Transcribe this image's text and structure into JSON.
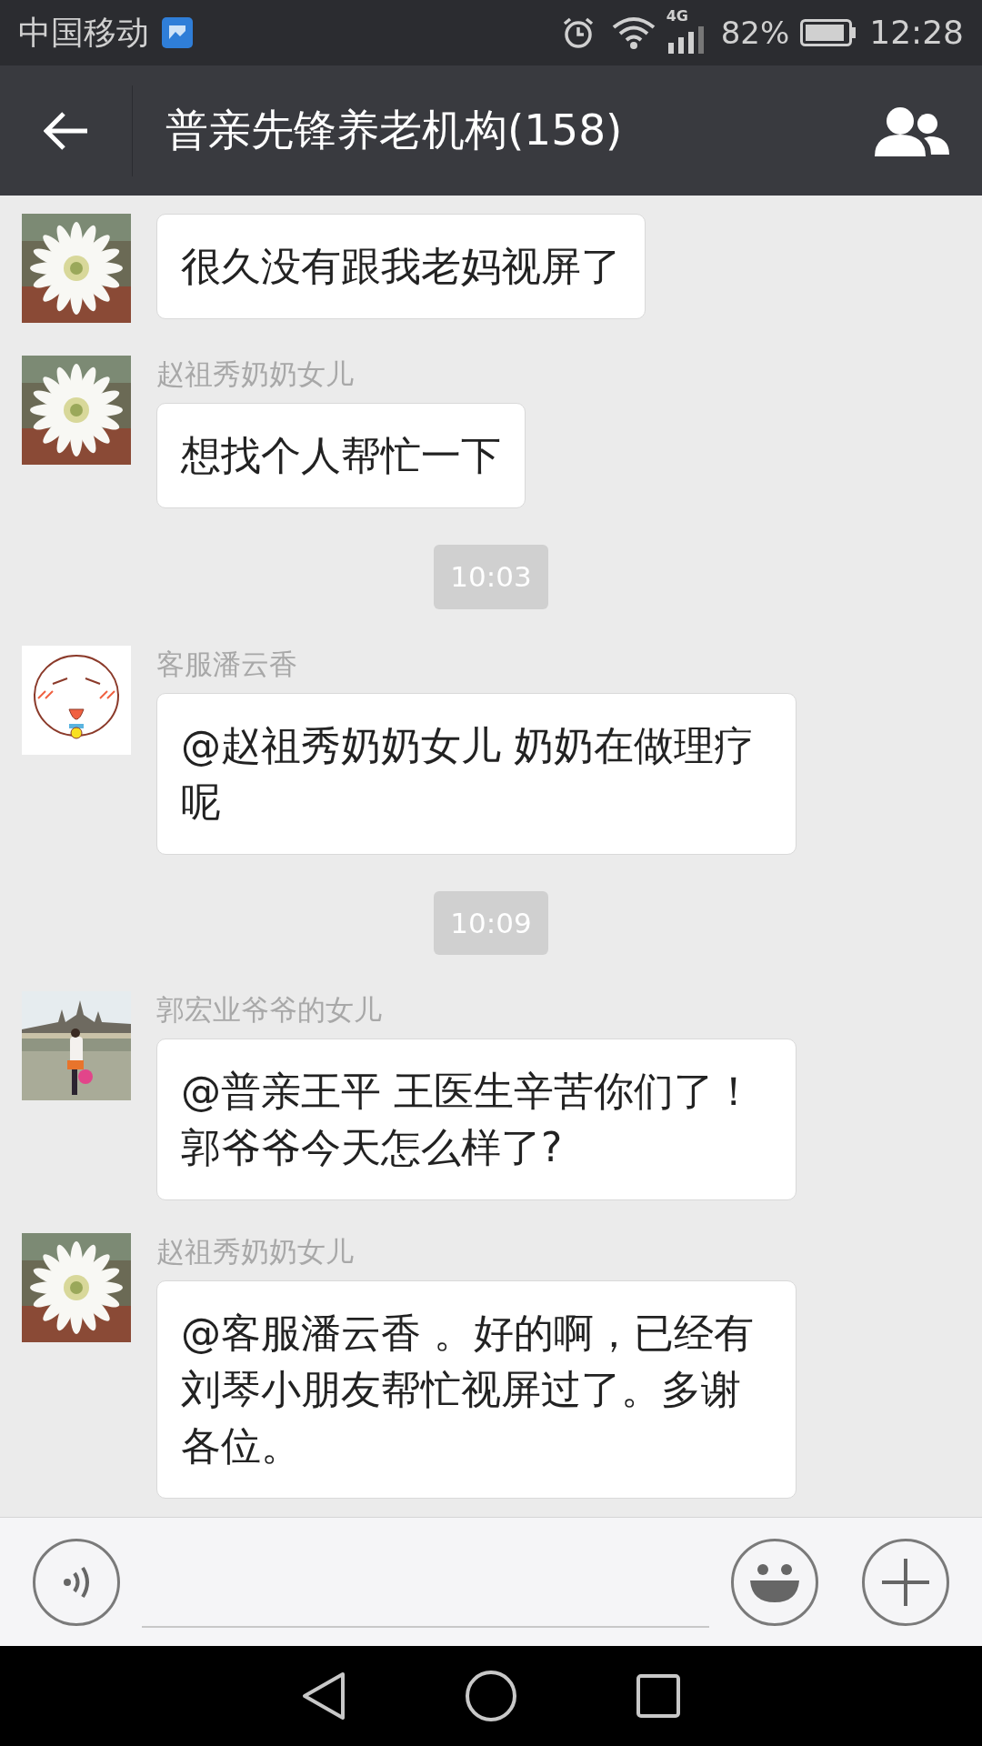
{
  "status_bar": {
    "carrier": "中国移动",
    "network": "4G",
    "battery": "82%",
    "time": "12:28"
  },
  "header": {
    "title": "普亲先锋养老机构(158)"
  },
  "messages": [
    {
      "kind": "message",
      "avatar": {
        "kind": "flower"
      },
      "text": "很久没有跟我老妈视屏了"
    },
    {
      "kind": "message",
      "avatar": {
        "kind": "flower"
      },
      "sender": "赵祖秀奶奶女儿",
      "text": "想找个人帮忙一下"
    },
    {
      "kind": "time",
      "text": "10:03"
    },
    {
      "kind": "message",
      "avatar": {
        "kind": "cat"
      },
      "sender": "客服潘云香",
      "text": "@赵祖秀奶奶女儿 奶奶在做理疗呢"
    },
    {
      "kind": "time",
      "text": "10:09"
    },
    {
      "kind": "message",
      "avatar": {
        "kind": "lake"
      },
      "sender": "郭宏业爷爷的女儿",
      "text": "@普亲王平 王医生辛苦你们了！郭爷爷今天怎么样了?"
    },
    {
      "kind": "message",
      "avatar": {
        "kind": "flower"
      },
      "sender": "赵祖秀奶奶女儿",
      "text": "@客服潘云香 。好的啊，已经有刘琴小朋友帮忙视屏过了。多谢各位。"
    }
  ]
}
